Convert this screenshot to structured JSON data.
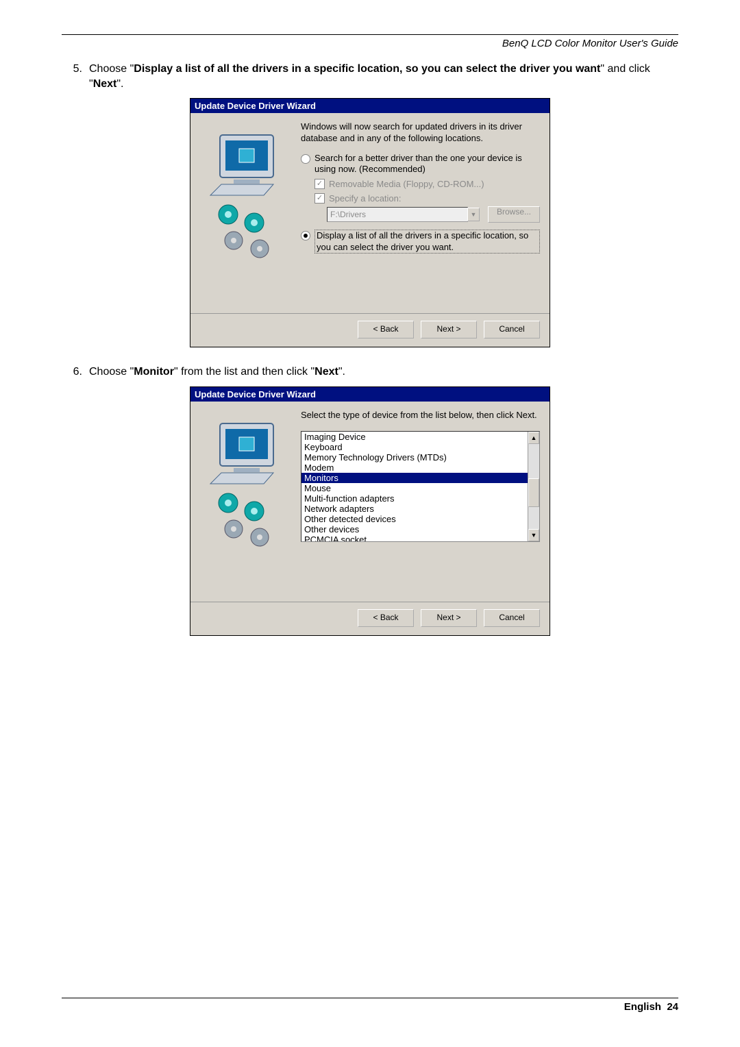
{
  "header": {
    "title": "BenQ LCD Color Monitor User's Guide"
  },
  "steps": {
    "s5": {
      "num": "5.",
      "pre": "Choose \"",
      "bold1": "Display a list of all the drivers in a specific location, so you can select the driver you want",
      "mid": "\" and click \"",
      "bold2": "Next",
      "post": "\"."
    },
    "s6": {
      "num": "6.",
      "pre": "Choose \"",
      "bold1": "Monitor",
      "mid": "\" from the list and then click \"",
      "bold2": "Next",
      "post": "\"."
    }
  },
  "dialog1": {
    "title": "Update Device Driver Wizard",
    "intro": "Windows will now search for updated drivers in its driver database and in any of the following locations.",
    "radio1": "Search for a better driver than the one your device is using now. (Recommended)",
    "chk1": "Removable Media (Floppy, CD-ROM...)",
    "chk2": "Specify a location:",
    "path": "F:\\Drivers",
    "browse": "Browse...",
    "radio2": "Display a list of all the drivers in a specific location, so you can select the driver you want.",
    "back": "< Back",
    "next": "Next >",
    "cancel": "Cancel"
  },
  "dialog2": {
    "title": "Update Device Driver Wizard",
    "intro": "Select the type of device from the list below, then click Next.",
    "items": [
      "Imaging Device",
      "Keyboard",
      "Memory Technology Drivers (MTDs)",
      "Modem",
      "Monitors",
      "Mouse",
      "Multi-function adapters",
      "Network adapters",
      "Other detected devices",
      "Other devices",
      "PCMCIA socket"
    ],
    "selected_index": 4,
    "back": "< Back",
    "next": "Next >",
    "cancel": "Cancel"
  },
  "footer": {
    "lang": "English",
    "page": "24"
  }
}
